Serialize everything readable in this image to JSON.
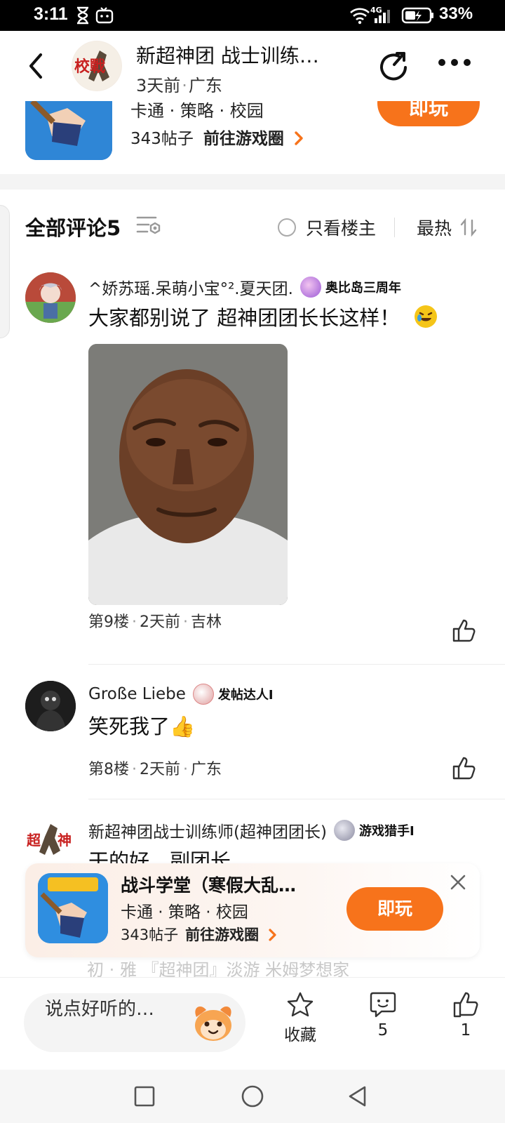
{
  "status_bar": {
    "time": "3:11",
    "battery": "33%",
    "signal": "4G"
  },
  "header": {
    "title": "新超神团 战士训练…",
    "time_ago": "3天前",
    "location": "广东",
    "avatar_text": "校戰"
  },
  "game_card_top": {
    "tags": "卡通 · 策略 · 校园",
    "posts": "343帖子",
    "link": "前往游戏圈",
    "play_label": "即玩"
  },
  "comments_header": {
    "title": "全部评论5",
    "only_op_label": "只看楼主",
    "sort_label": "最热"
  },
  "comments": [
    {
      "username": "^娇苏瑶.呆萌小宝°².夏天团.",
      "badge": "奥比岛三周年",
      "text": "大家都别说了 超神团团长长这样！",
      "floor": "第9楼",
      "time": "2天前",
      "location": "吉林"
    },
    {
      "username": "Große Liebe",
      "badge": "发帖达人I",
      "text": "笑死我了👍",
      "floor": "第8楼",
      "time": "2天前",
      "location": "广东"
    },
    {
      "username": "新超神团战士训练师(超神团团长)",
      "badge": "游戏猎手I",
      "text": "干的好，副团长"
    }
  ],
  "float_card": {
    "title": "战斗学堂（寒假大乱…",
    "tags": "卡通 · 策略 · 校园",
    "posts": "343帖子",
    "link": "前往游戏圈",
    "play_label": "即玩"
  },
  "ghost_text": "初 · 雅 『超神团』淡游  米姆梦想家",
  "bottom_bar": {
    "reply_placeholder": "说点好听的…",
    "favorite_label": "收藏",
    "comment_count": "5",
    "like_count": "1"
  },
  "colors": {
    "accent": "#f7731b",
    "text": "#111111",
    "muted": "#999999"
  }
}
